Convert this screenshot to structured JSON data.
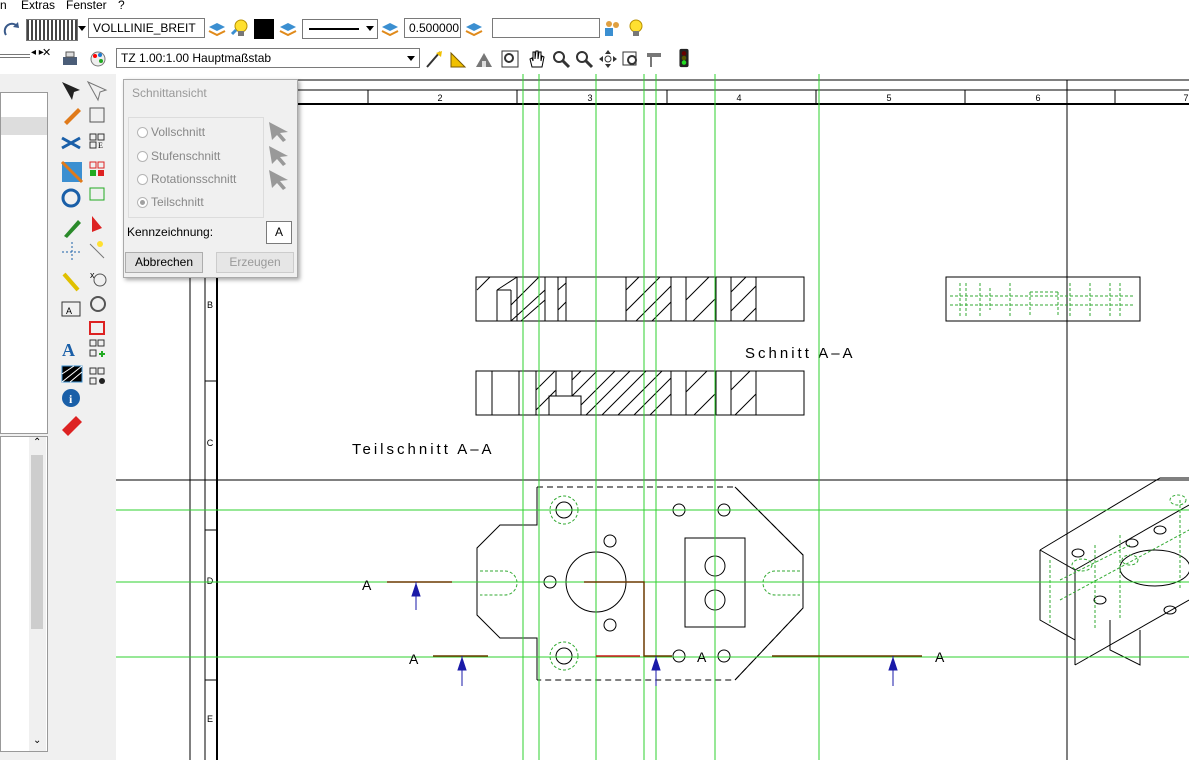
{
  "menu": {
    "items": [
      "n",
      "Extras",
      "Fenster",
      "?"
    ]
  },
  "toolbar1": {
    "line_type": "VOLLLINIE_BREIT",
    "line_width": "0.500000",
    "empty_field": ""
  },
  "toolbar2": {
    "scale_select": "TZ 1.00:1.00 Hauptmaßstab"
  },
  "dialog": {
    "title": "Schnittansicht",
    "options": [
      {
        "label": "Vollschnitt",
        "selected": false
      },
      {
        "label": "Stufenschnitt",
        "selected": false
      },
      {
        "label": "Rotationsschnitt",
        "selected": false
      },
      {
        "label": "Teilschnitt",
        "selected": true
      }
    ],
    "kennzeichnung_label": "Kennzeichnung:",
    "kennzeichnung_value": "A",
    "cancel_label": "Abbrechen",
    "create_label": "Erzeugen"
  },
  "drawing": {
    "column_numbers": [
      "2",
      "3",
      "4",
      "5",
      "6",
      "7"
    ],
    "row_letters": [
      "B",
      "C",
      "D",
      "E"
    ],
    "label_schnitt": "Schnitt A–A",
    "label_teilschnitt": "Teilschnitt A–A",
    "section_marks": [
      "A",
      "A",
      "A",
      "A"
    ]
  },
  "colors": {
    "guide_line": "#2fd22f",
    "section_line": "#6b3a00",
    "arrow": "#1a1aa8",
    "hidden_line": "#33aa33"
  }
}
